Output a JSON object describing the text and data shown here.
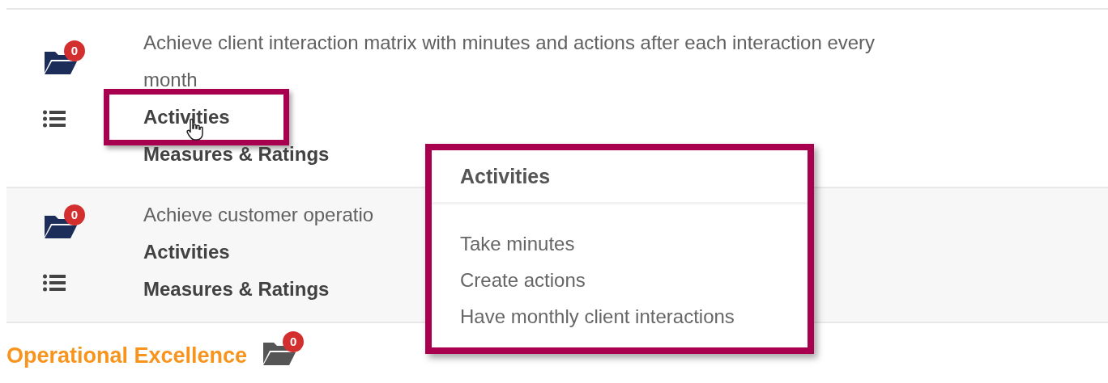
{
  "goals": [
    {
      "text": "Achieve client interaction matrix with minutes and actions after each interaction every month",
      "badge": "0",
      "shaded": false,
      "highlighted": true,
      "links": [
        "Activities",
        "Measures & Ratings"
      ]
    },
    {
      "text": "Achieve customer operatio",
      "badge": "0",
      "shaded": true,
      "highlighted": false,
      "links": [
        "Activities",
        "Measures & Ratings"
      ]
    }
  ],
  "popover": {
    "title": "Activities",
    "items": [
      "Take minutes",
      "Create actions",
      "Have monthly client interactions"
    ]
  },
  "section": {
    "title": "Operational Excellence",
    "badge": "0"
  }
}
